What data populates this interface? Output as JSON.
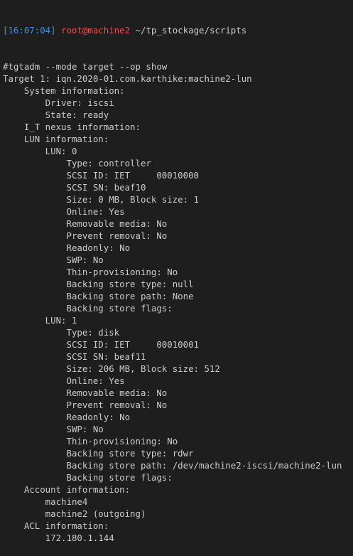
{
  "prompt": {
    "time": "[16:07:04]",
    "user_host": "root@machine2",
    "path": "~/tp_stockage/scripts"
  },
  "colors": {
    "background": "#1e1e1e",
    "text": "#cccccc",
    "time": "#3b8eea",
    "user_host": "#f14c4c"
  },
  "output": [
    {
      "indent": 0,
      "text": "#tgtadm --mode target --op show"
    },
    {
      "indent": 0,
      "text": "Target 1: iqn.2020-01.com.karthike:machine2-lun"
    },
    {
      "indent": 1,
      "text": "System information:"
    },
    {
      "indent": 2,
      "text": "Driver: iscsi"
    },
    {
      "indent": 2,
      "text": "State: ready"
    },
    {
      "indent": 1,
      "text": "I_T nexus information:"
    },
    {
      "indent": 1,
      "text": "LUN information:"
    },
    {
      "indent": 2,
      "text": "LUN: 0"
    },
    {
      "indent": 3,
      "text": "Type: controller"
    },
    {
      "indent": 3,
      "text": "SCSI ID: IET     00010000"
    },
    {
      "indent": 3,
      "text": "SCSI SN: beaf10"
    },
    {
      "indent": 3,
      "text": "Size: 0 MB, Block size: 1"
    },
    {
      "indent": 3,
      "text": "Online: Yes"
    },
    {
      "indent": 3,
      "text": "Removable media: No"
    },
    {
      "indent": 3,
      "text": "Prevent removal: No"
    },
    {
      "indent": 3,
      "text": "Readonly: No"
    },
    {
      "indent": 3,
      "text": "SWP: No"
    },
    {
      "indent": 3,
      "text": "Thin-provisioning: No"
    },
    {
      "indent": 3,
      "text": "Backing store type: null"
    },
    {
      "indent": 3,
      "text": "Backing store path: None"
    },
    {
      "indent": 3,
      "text": "Backing store flags:"
    },
    {
      "indent": 2,
      "text": "LUN: 1"
    },
    {
      "indent": 3,
      "text": "Type: disk"
    },
    {
      "indent": 3,
      "text": "SCSI ID: IET     00010001"
    },
    {
      "indent": 3,
      "text": "SCSI SN: beaf11"
    },
    {
      "indent": 3,
      "text": "Size: 206 MB, Block size: 512"
    },
    {
      "indent": 3,
      "text": "Online: Yes"
    },
    {
      "indent": 3,
      "text": "Removable media: No"
    },
    {
      "indent": 3,
      "text": "Prevent removal: No"
    },
    {
      "indent": 3,
      "text": "Readonly: No"
    },
    {
      "indent": 3,
      "text": "SWP: No"
    },
    {
      "indent": 3,
      "text": "Thin-provisioning: No"
    },
    {
      "indent": 3,
      "text": "Backing store type: rdwr"
    },
    {
      "indent": 3,
      "text": "Backing store path: /dev/machine2-iscsi/machine2-lun"
    },
    {
      "indent": 3,
      "text": "Backing store flags:"
    },
    {
      "indent": 1,
      "text": "Account information:"
    },
    {
      "indent": 2,
      "text": "machine4"
    },
    {
      "indent": 2,
      "text": "machine2 (outgoing)"
    },
    {
      "indent": 1,
      "text": "ACL information:"
    },
    {
      "indent": 2,
      "text": "172.180.1.144"
    }
  ]
}
